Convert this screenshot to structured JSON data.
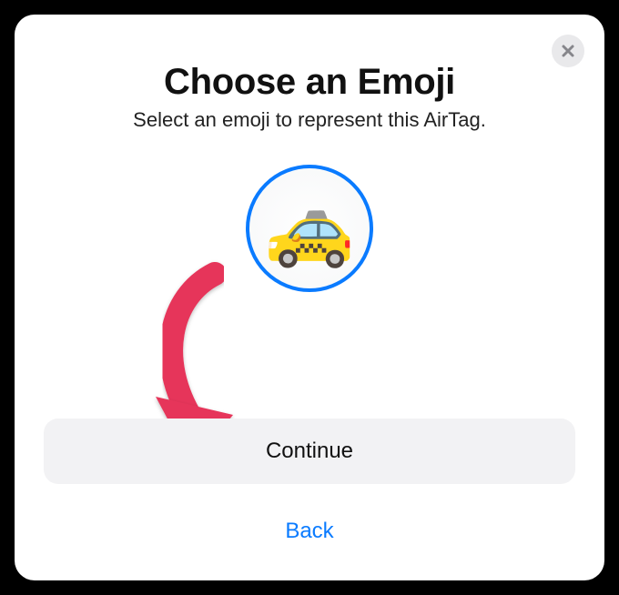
{
  "colors": {
    "accent": "#0a7bff",
    "arrow": "#e6365a"
  },
  "modal": {
    "title": "Choose an Emoji",
    "subtitle": "Select an emoji to represent this AirTag.",
    "selected_emoji": "🚕",
    "continue_label": "Continue",
    "back_label": "Back"
  }
}
